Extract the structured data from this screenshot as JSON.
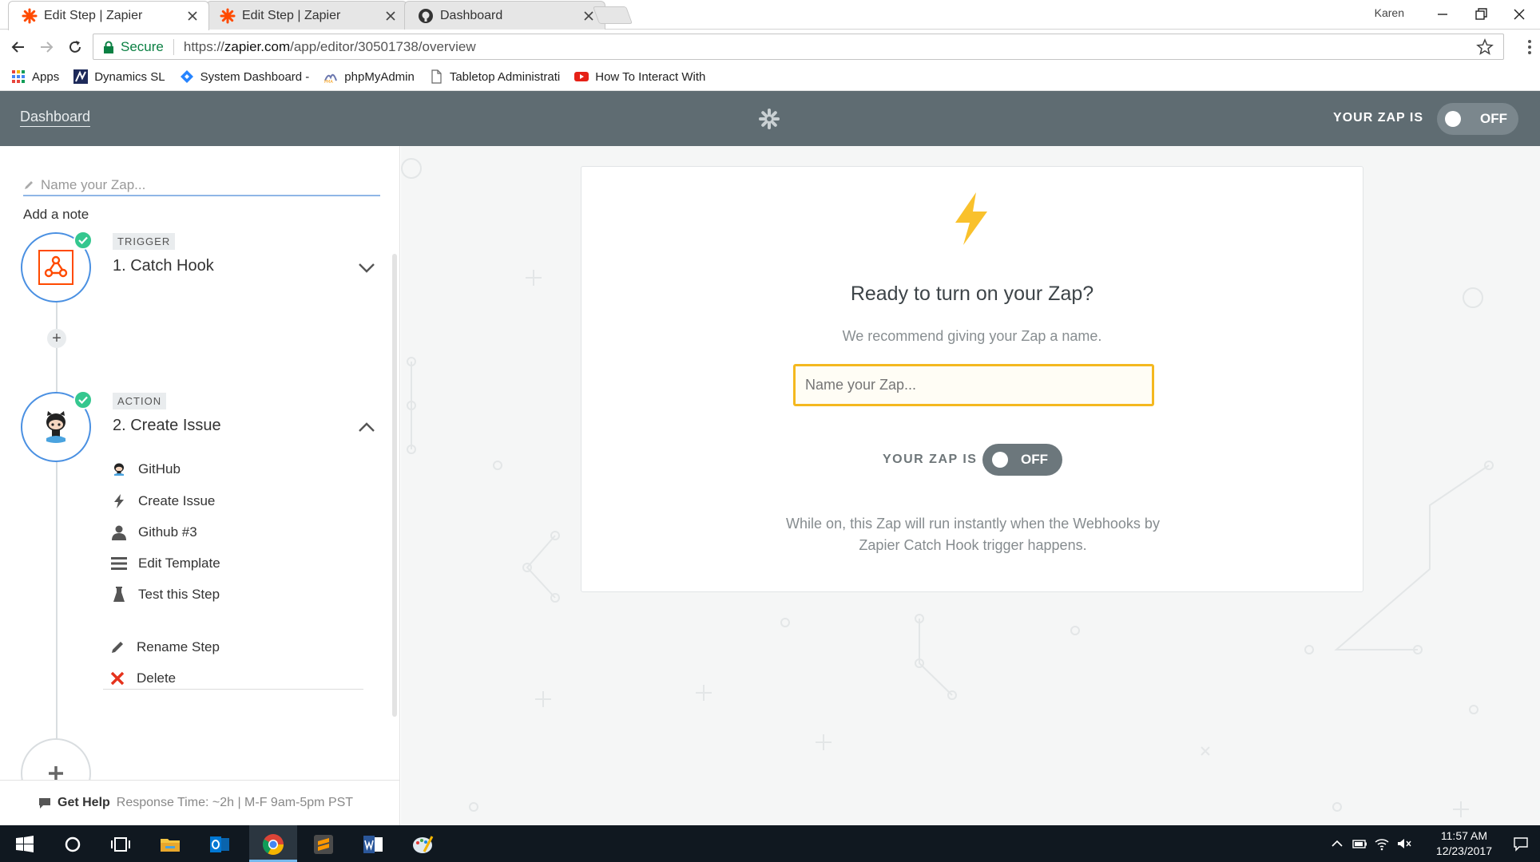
{
  "browser": {
    "tabs": [
      {
        "title": "Edit Step | Zapier",
        "icon": "zapier-icon",
        "active": true
      },
      {
        "title": "Edit Step | Zapier",
        "icon": "zapier-icon",
        "active": false
      },
      {
        "title": "Dashboard",
        "icon": "github-icon",
        "active": false
      }
    ],
    "profile_name": "Karen",
    "secure_label": "Secure",
    "url_scheme": "https://",
    "url_host": "zapier.com",
    "url_path": "/app/editor/30501738/overview",
    "bookmarks": [
      {
        "label": "Apps",
        "icon": "apps-grid-icon"
      },
      {
        "label": "Dynamics SL",
        "icon": "dynamics-icon"
      },
      {
        "label": "System Dashboard - ",
        "icon": "jira-icon"
      },
      {
        "label": "phpMyAdmin",
        "icon": "phpmyadmin-icon"
      },
      {
        "label": "Tabletop Administrati",
        "icon": "page-icon"
      },
      {
        "label": "How To Interact With",
        "icon": "youtube-icon"
      }
    ]
  },
  "header": {
    "dashboard_label": "Dashboard",
    "zap_status_label": "YOUR ZAP IS",
    "toggle_label": "OFF"
  },
  "sidebar": {
    "name_placeholder": "Name your Zap...",
    "add_note_label": "Add a note",
    "trigger": {
      "badge": "TRIGGER",
      "title": "1. Catch Hook"
    },
    "action": {
      "badge": "ACTION",
      "title": "2. Create Issue",
      "items": [
        {
          "label": "GitHub",
          "icon": "github-icon"
        },
        {
          "label": "Create Issue",
          "icon": "bolt-icon"
        },
        {
          "label": "Github #3",
          "icon": "person-icon"
        },
        {
          "label": "Edit Template",
          "icon": "lines-icon"
        },
        {
          "label": "Test this Step",
          "icon": "flask-icon"
        }
      ],
      "extra": [
        {
          "label": "Rename Step",
          "icon": "pencil-icon"
        },
        {
          "label": "Delete",
          "icon": "delete-x-icon"
        }
      ]
    },
    "help": {
      "title": "Get Help",
      "info": "Response Time: ~2h | M-F 9am-5pm PST"
    }
  },
  "main": {
    "title": "Ready to turn on your Zap?",
    "subtitle": "We recommend giving your Zap a name.",
    "name_placeholder": "Name your Zap...",
    "zap_status_label": "YOUR ZAP IS",
    "toggle_label": "OFF",
    "note": "While on, this Zap will run instantly when the Webhooks by Zapier Catch Hook trigger happens."
  },
  "taskbar": {
    "time": "11:57 AM",
    "date": "12/23/2017"
  },
  "colors": {
    "header_bg": "#5f6c72",
    "accent_blue": "#4a90e2",
    "success_green": "#35c78f",
    "zapier_orange": "#ff4a00",
    "input_border": "#f4b81f",
    "bolt_yellow": "#f9c12c"
  }
}
